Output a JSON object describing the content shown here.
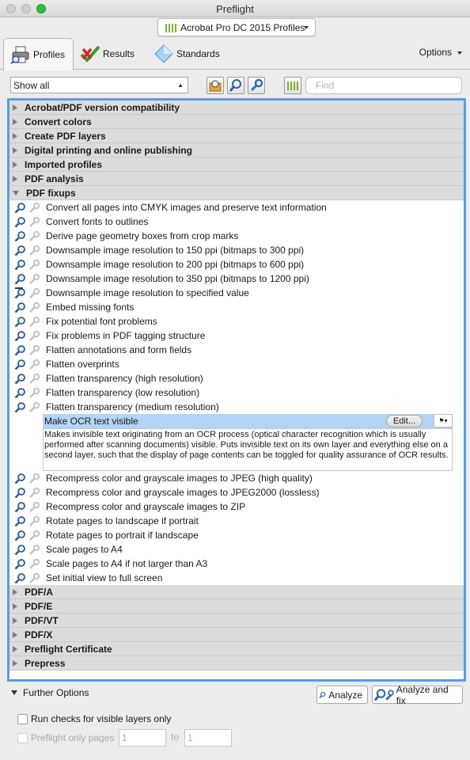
{
  "window": {
    "title": "Preflight"
  },
  "profile_select": {
    "value": "Acrobat Pro DC 2015 Profiles"
  },
  "tabs": [
    {
      "label": "Profiles",
      "icon": "printer-icon"
    },
    {
      "label": "Results",
      "icon": "results-check-icon"
    },
    {
      "label": "Standards",
      "icon": "diamond-icon"
    }
  ],
  "options_label": "Options",
  "filter_select": {
    "value": "Show all"
  },
  "search": {
    "placeholder": "Find"
  },
  "groups_top": [
    "Acrobat/PDF version compatibility",
    "Convert colors",
    "Create PDF layers",
    "Digital printing and online publishing",
    "Imported profiles",
    "PDF analysis"
  ],
  "open_group": "PDF fixups",
  "fixups_before": [
    "Convert all pages into CMYK images and preserve text information",
    "Convert fonts to outlines",
    "Derive page geometry boxes from crop marks",
    "Downsample image resolution to 150 ppi (bitmaps to 300 ppi)",
    "Downsample image resolution to 200 ppi (bitmaps to 600 ppi)",
    "Downsample image resolution to 350 ppi (bitmaps to 1200 ppi)",
    "Downsample image resolution to specified value",
    "Embed missing fonts",
    "Fix potential font problems",
    "Fix problems in PDF tagging structure",
    "Flatten annotations and form fields",
    "Flatten overprints",
    "Flatten transparency (high resolution)",
    "Flatten transparency (low resolution)",
    "Flatten transparency (medium resolution)"
  ],
  "selected_fixup": {
    "label": "Make OCR text visible",
    "edit_label": "Edit...",
    "description": "Makes invisible text originating from an OCR process (optical character recognition which is usually performed after scanning documents) visible. Puts invisible text on its own layer and everything else on a second layer, such that the display of page contents can be toggled for quality assurance of OCR results."
  },
  "fixups_after": [
    "Recompress color and grayscale images to JPEG (high quality)",
    "Recompress color and grayscale images to JPEG2000 (lossless)",
    "Recompress color and grayscale images to ZIP",
    "Rotate pages to landscape if portrait",
    "Rotate pages to portrait if landscape",
    "Scale pages to A4",
    "Scale pages to A4 if not larger than A3",
    "Set initial view to full screen"
  ],
  "groups_bottom": [
    "PDF/A",
    "PDF/E",
    "PDF/VT",
    "PDF/X",
    "Preflight Certificate",
    "Prepress"
  ],
  "further_options": "Further Options",
  "analyze_label": "Analyze",
  "analyze_fix_label": "Analyze and fix",
  "visible_layers_label": "Run checks for visible layers only",
  "preflight_pages_label": "Preflight only pages",
  "page_from": "1",
  "page_to_label": "to",
  "page_to": "1",
  "colors": {
    "accent": "#5b9be5",
    "selection": "#b3d4f7",
    "profile_green": "#7bb32e"
  }
}
